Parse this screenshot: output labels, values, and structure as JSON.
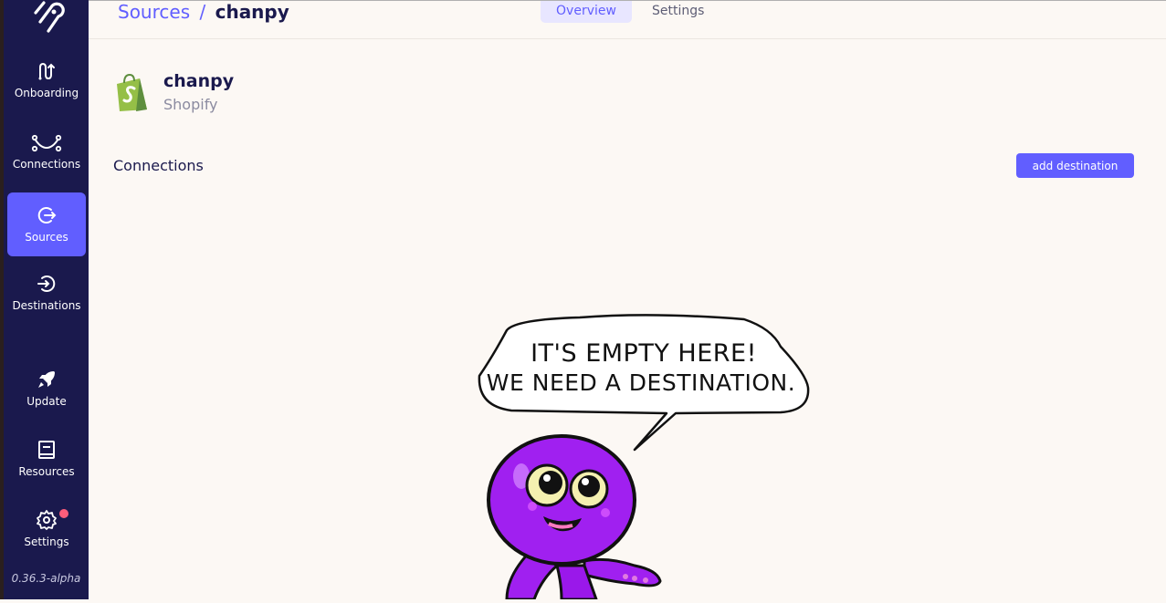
{
  "breadcrumb": {
    "parent": "Sources",
    "separator": "/",
    "current": "chanpy"
  },
  "tabs": {
    "overview": "Overview",
    "settings": "Settings"
  },
  "sidebar": {
    "items": [
      {
        "label": "Onboarding",
        "icon": "onboarding-icon"
      },
      {
        "label": "Connections",
        "icon": "connections-icon"
      },
      {
        "label": "Sources",
        "icon": "sources-icon",
        "active": true
      },
      {
        "label": "Destinations",
        "icon": "destinations-icon"
      },
      {
        "label": "Update",
        "icon": "rocket-icon"
      },
      {
        "label": "Resources",
        "icon": "book-icon"
      },
      {
        "label": "Settings",
        "icon": "gear-icon",
        "has_notification": true
      }
    ],
    "version": "0.36.3-alpha"
  },
  "source": {
    "name": "chanpy",
    "type": "Shopify",
    "icon": "shopify-icon"
  },
  "connections": {
    "title": "Connections",
    "add_button": "add destination"
  },
  "empty_state": {
    "line1": "IT'S EMPTY HERE!",
    "line2": "WE NEED A DESTINATION."
  },
  "colors": {
    "sidebar_bg": "#1a194d",
    "accent": "#615eff",
    "page_bg": "#fcf8f4",
    "notification": "#ff5e7b",
    "octopus": "#a020f0"
  }
}
